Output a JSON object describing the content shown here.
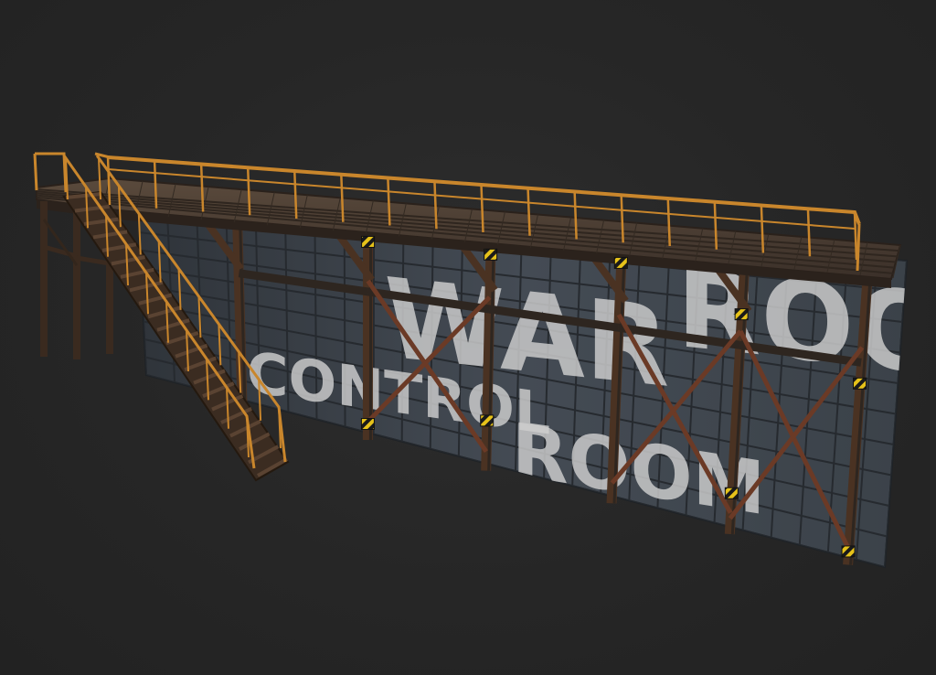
{
  "scene": {
    "wall_text": {
      "line1": "WAR",
      "line1_tail": "ROOM",
      "line2": "CONTROL",
      "line2_tail": "ROOM"
    },
    "colors": {
      "background": "#262626",
      "panel": "#3a4048",
      "panel_grid": "#262a2f",
      "rust_steel": "#4a3222",
      "dark_steel": "#2e2620",
      "railing": "#c9862c",
      "hazard_yellow": "#e6c21a",
      "hazard_black": "#1a1a1a"
    }
  }
}
